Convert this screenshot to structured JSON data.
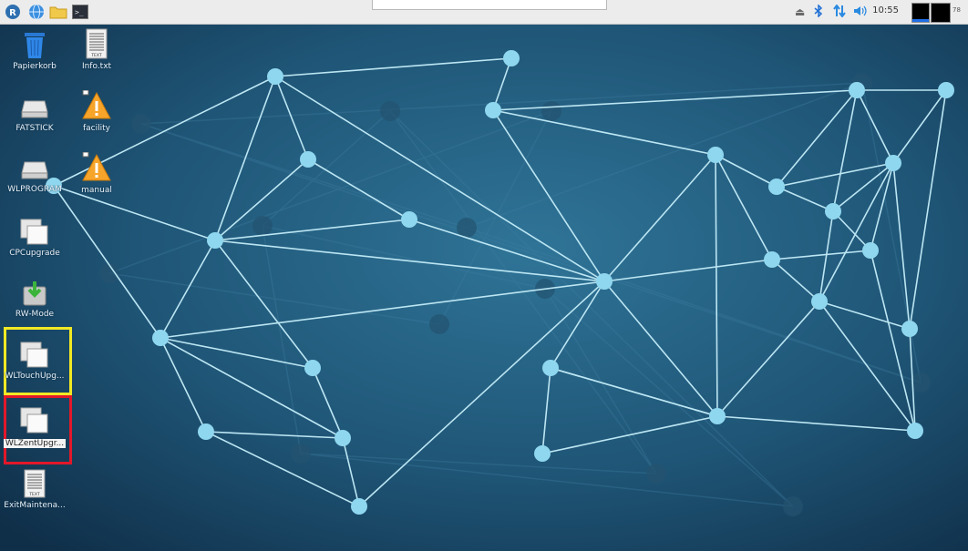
{
  "taskbar": {
    "menu_icon": "raspberry-menu-icon",
    "launchers": [
      "globe-icon",
      "folder-icon",
      "terminal-icon"
    ],
    "clock": "10:55",
    "tray_icons": [
      "eject-icon",
      "bluetooth-icon",
      "network-icon",
      "volume-icon"
    ],
    "cpu_value": "78"
  },
  "desktop": {
    "icons": [
      {
        "label": "Papierkorb",
        "icon": "trash-icon"
      },
      {
        "label": "Info.txt",
        "icon": "text-file-icon",
        "badge": "TEXT"
      },
      {
        "label": "FATSTICK",
        "icon": "drive-icon"
      },
      {
        "label": "facility",
        "icon": "warning-icon"
      },
      {
        "label": "WLPROGRAM",
        "icon": "drive-icon"
      },
      {
        "label": "manual",
        "icon": "warning-icon"
      },
      {
        "label": "CPCupgrade",
        "icon": "window-icon"
      },
      {
        "label": "RW-Mode",
        "icon": "install-icon"
      },
      {
        "label": "WLTouchUpg...",
        "icon": "window-icon"
      },
      {
        "label": "WLZentUpgr...",
        "icon": "window-icon"
      },
      {
        "label": "ExitMaintena...",
        "icon": "text-file-icon",
        "badge": "TEXT"
      }
    ],
    "highlights": {
      "yellow": "#f2e824",
      "red": "#e2182a"
    }
  },
  "colors": {
    "wallpaper_dark": "#133550",
    "wallpaper_light": "#2a6a8c",
    "network_node": "#8fd7ef",
    "network_line": "#bce6f3"
  }
}
